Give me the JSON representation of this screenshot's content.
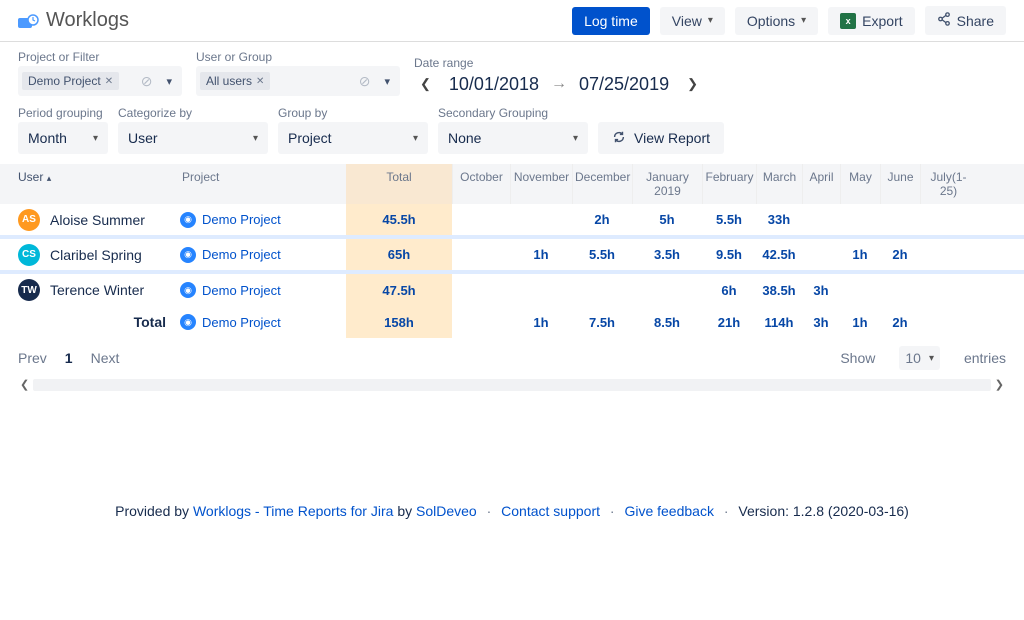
{
  "app": {
    "title": "Worklogs"
  },
  "toolbar": {
    "logtime": "Log time",
    "view": "View",
    "options": "Options",
    "export": "Export",
    "share": "Share"
  },
  "filters": {
    "project_label": "Project or Filter",
    "project_chip": "Demo Project",
    "user_label": "User or Group",
    "user_chip": "All users",
    "date_label": "Date range",
    "date_from": "10/01/2018",
    "date_to": "07/25/2019"
  },
  "controls": {
    "period_label": "Period grouping",
    "period": "Month",
    "categorize_label": "Categorize by",
    "categorize": "User",
    "group_label": "Group by",
    "group": "Project",
    "secondary_label": "Secondary Grouping",
    "secondary": "None",
    "view_report": "View Report"
  },
  "table": {
    "head_user": "User",
    "head_project": "Project",
    "head_total": "Total",
    "months": [
      "October",
      "November",
      "December",
      "January 2019",
      "February",
      "March",
      "April",
      "May",
      "June",
      "July(1-25)"
    ],
    "rows": [
      {
        "user": "Aloise Summer",
        "initials": "AS",
        "color": "#FF991F",
        "project": "Demo Project",
        "total": "45.5h",
        "cells": [
          "",
          "",
          "2h",
          "5h",
          "5.5h",
          "33h",
          "",
          "",
          "",
          ""
        ]
      },
      {
        "user": "Claribel Spring",
        "initials": "CS",
        "color": "#00B8D9",
        "project": "Demo Project",
        "total": "65h",
        "cells": [
          "",
          "1h",
          "5.5h",
          "3.5h",
          "9.5h",
          "42.5h",
          "",
          "1h",
          "2h",
          ""
        ]
      },
      {
        "user": "Terence Winter",
        "initials": "TW",
        "color": "#172B4D",
        "project": "Demo Project",
        "total": "47.5h",
        "cells": [
          "",
          "",
          "",
          "",
          "6h",
          "38.5h",
          "3h",
          "",
          "",
          ""
        ]
      }
    ],
    "total_label": "Total",
    "total_row": {
      "project": "Demo Project",
      "total": "158h",
      "cells": [
        "",
        "1h",
        "7.5h",
        "8.5h",
        "21h",
        "114h",
        "3h",
        "1h",
        "2h",
        ""
      ]
    }
  },
  "pager": {
    "prev": "Prev",
    "page": "1",
    "next": "Next",
    "show": "Show",
    "count": "10",
    "entries": "entries"
  },
  "footer": {
    "provided": "Provided by ",
    "link1": "Worklogs - Time Reports for Jira",
    "by": " by ",
    "link2": "SolDeveo",
    "support": "Contact support",
    "feedback": "Give feedback",
    "version": "Version: 1.2.8 (2020-03-16)"
  }
}
